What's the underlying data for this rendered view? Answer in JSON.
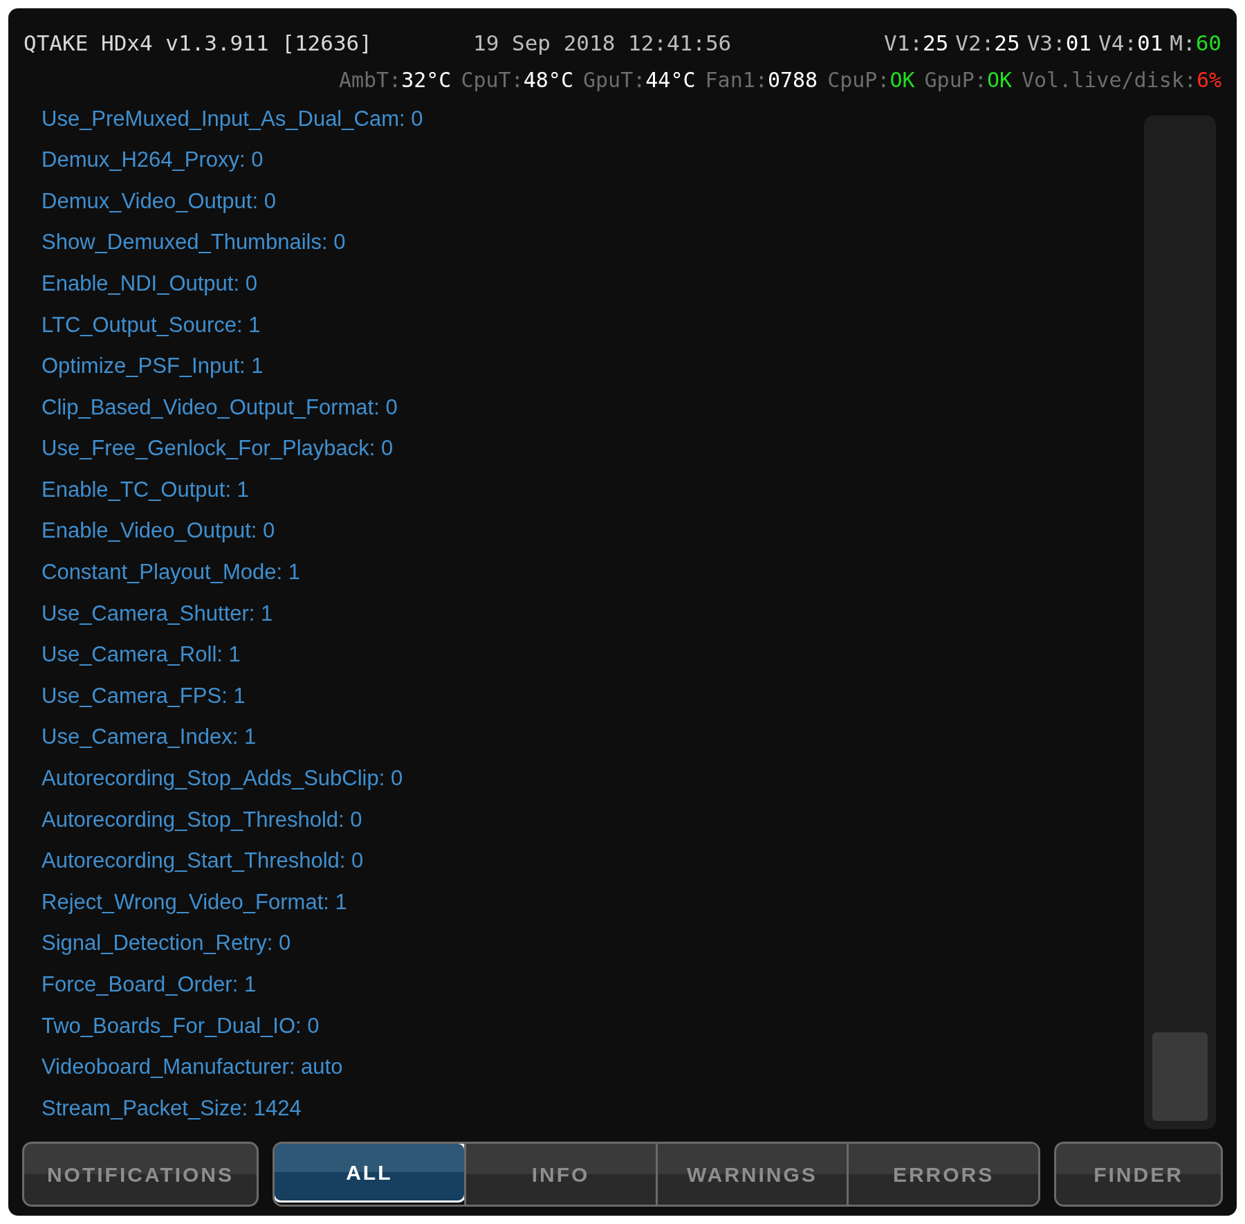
{
  "header": {
    "title": "QTAKE HDx4 v1.3.911 [12636]",
    "datetime": "19 Sep 2018 12:41:56",
    "rates": [
      {
        "label": "V1:",
        "value": "25",
        "color": "#ffffff"
      },
      {
        "label": "V2:",
        "value": "25",
        "color": "#ffffff"
      },
      {
        "label": "V3:",
        "value": "01",
        "color": "#ffffff"
      },
      {
        "label": "V4:",
        "value": "01",
        "color": "#ffffff"
      },
      {
        "label": "M:",
        "value": "60",
        "color": "#22dd22"
      }
    ],
    "sensors": [
      {
        "label": "AmbT:",
        "value": "32°C",
        "color": "#ffffff"
      },
      {
        "label": "CpuT:",
        "value": "48°C",
        "color": "#ffffff"
      },
      {
        "label": "GpuT:",
        "value": "44°C",
        "color": "#ffffff"
      },
      {
        "label": "Fan1:",
        "value": "0788",
        "color": "#ffffff"
      },
      {
        "label": "CpuP:",
        "value": "OK",
        "color": "#22dd22"
      },
      {
        "label": "GpuP:",
        "value": "OK",
        "color": "#22dd22"
      },
      {
        "label": "Vol.live/disk:",
        "value": "6%",
        "color": "#ff2a1a"
      }
    ]
  },
  "log": [
    "Use_PreMuxed_Input_As_Dual_Cam: 0",
    "Demux_H264_Proxy: 0",
    "Demux_Video_Output: 0",
    "Show_Demuxed_Thumbnails: 0",
    "Enable_NDI_Output: 0",
    "LTC_Output_Source: 1",
    "Optimize_PSF_Input: 1",
    "Clip_Based_Video_Output_Format: 0",
    "Use_Free_Genlock_For_Playback: 0",
    "Enable_TC_Output: 1",
    "Enable_Video_Output: 0",
    "Constant_Playout_Mode: 1",
    "Use_Camera_Shutter: 1",
    "Use_Camera_Roll: 1",
    "Use_Camera_FPS: 1",
    "Use_Camera_Index: 1",
    "Autorecording_Stop_Adds_SubClip: 0",
    "Autorecording_Stop_Threshold: 0",
    "Autorecording_Start_Threshold: 0",
    "Reject_Wrong_Video_Format: 1",
    "Signal_Detection_Retry: 0",
    "Force_Board_Order: 1",
    "Two_Boards_For_Dual_IO: 0",
    "Videoboard_Manufacturer: auto",
    "Stream_Packet_Size: 1424"
  ],
  "notifications_button": "NOTIFICATIONS",
  "filters": [
    {
      "label": "ALL",
      "selected": true
    },
    {
      "label": "INFO",
      "selected": false
    },
    {
      "label": "WARNINGS",
      "selected": false
    },
    {
      "label": "ERRORS",
      "selected": false
    }
  ],
  "finder_button": "FINDER"
}
